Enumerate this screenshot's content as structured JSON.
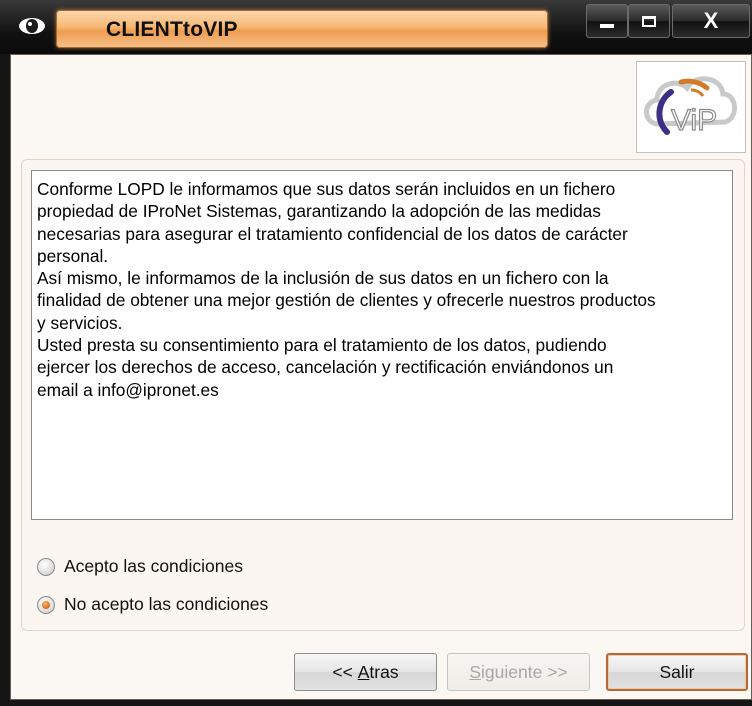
{
  "window": {
    "title": "CLIENTtoVIP",
    "controls": {
      "minimize": "—",
      "maximize": "☐",
      "close": "X"
    }
  },
  "logo": {
    "text": "ViP"
  },
  "lopd_text": "Conforme LOPD le informamos que sus datos serán incluidos en un fichero\npropiedad de IProNet Sistemas, garantizando la adopción de las medidas\nnecesarias para asegurar el tratamiento confidencial de los datos de carácter\npersonal.\nAsí mismo, le informamos de la inclusión de sus datos en un fichero con la\nfinalidad de obtener una mejor gestión de clientes y ofrecerle nuestros productos\ny servicios.\nUsted presta su consentimiento para el tratamiento de los datos, pudiendo\nejercer los derechos de acceso, cancelación y rectificación enviándonos un\nemail a info@ipronet.es",
  "options": [
    {
      "label": "Acepto las condiciones",
      "checked": false
    },
    {
      "label": "No acepto las condiciones",
      "checked": true
    }
  ],
  "buttons": {
    "back": {
      "pre": "<< ",
      "underlined": "A",
      "post": "tras"
    },
    "next": {
      "underlined": "S",
      "post": "iguiente >>"
    },
    "exit": "Salir"
  },
  "colors": {
    "title_accent": "#f6b874",
    "client_bg": "#fbf7f3",
    "radio_checked": "#d46b1a",
    "default_button_border": "#b26a3d"
  }
}
